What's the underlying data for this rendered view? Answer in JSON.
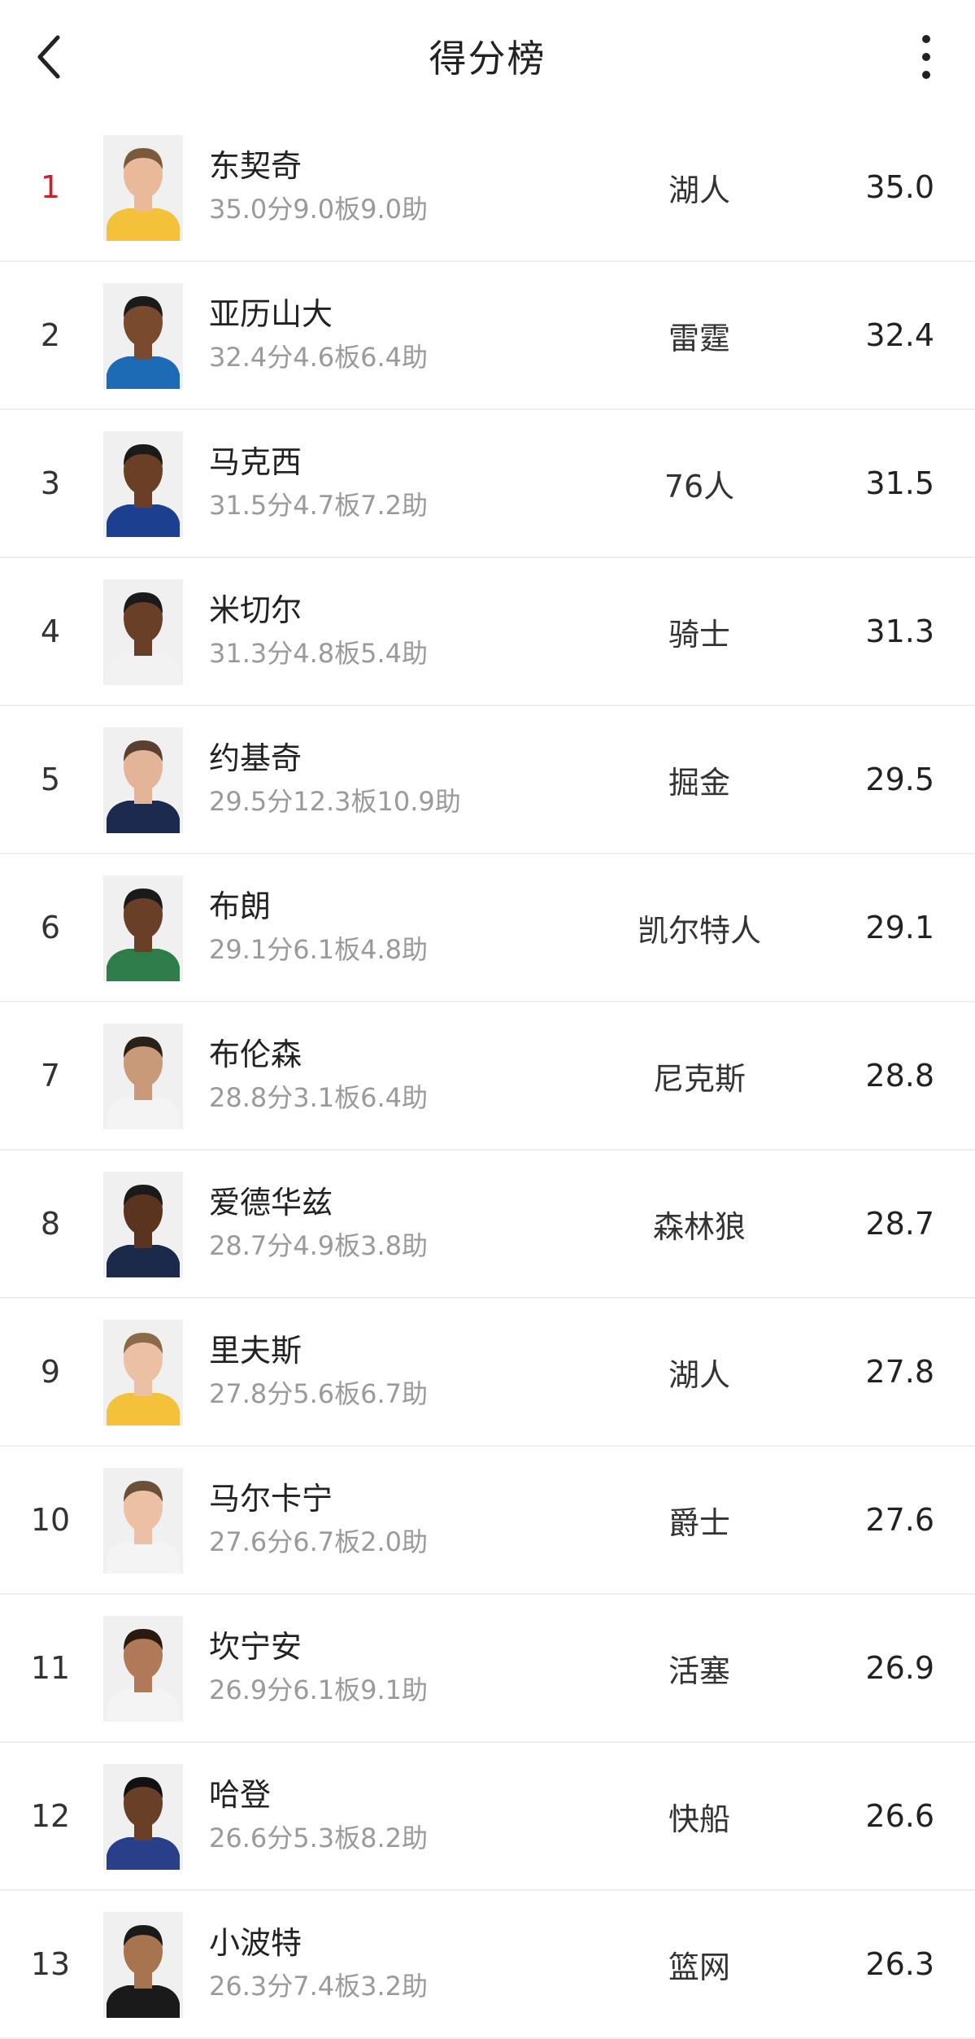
{
  "header": {
    "title": "得分榜",
    "back_icon": "chevron-left-icon",
    "more_icon": "more-vertical-icon"
  },
  "colors": {
    "highlight_rank": "#c8232c",
    "stats_text": "#9a9a9a"
  },
  "rows": [
    {
      "rank": "1",
      "name": "东契奇",
      "stats": "35.0分9.0板9.0助",
      "team": "湖人",
      "points": "35.0",
      "jersey": "#f3c13a",
      "skin": "#e9b99a",
      "hair": "#7a5a3a"
    },
    {
      "rank": "2",
      "name": "亚历山大",
      "stats": "32.4分4.6板6.4助",
      "team": "雷霆",
      "points": "32.4",
      "jersey": "#1e6bb5",
      "skin": "#7a4a2e",
      "hair": "#1a1a1a"
    },
    {
      "rank": "3",
      "name": "马克西",
      "stats": "31.5分4.7板7.2助",
      "team": "76人",
      "points": "31.5",
      "jersey": "#1c3f8f",
      "skin": "#6b3f26",
      "hair": "#1a1a1a"
    },
    {
      "rank": "4",
      "name": "米切尔",
      "stats": "31.3分4.8板5.4助",
      "team": "骑士",
      "points": "31.3",
      "jersey": "#f2f2f2",
      "skin": "#6a3f28",
      "hair": "#1a1a1a"
    },
    {
      "rank": "5",
      "name": "约基奇",
      "stats": "29.5分12.3板10.9助",
      "team": "掘金",
      "points": "29.5",
      "jersey": "#1d2a4f",
      "skin": "#e4b498",
      "hair": "#5a4030"
    },
    {
      "rank": "6",
      "name": "布朗",
      "stats": "29.1分6.1板4.8助",
      "team": "凯尔特人",
      "points": "29.1",
      "jersey": "#2e7d4a",
      "skin": "#6a3f28",
      "hair": "#1a1a1a"
    },
    {
      "rank": "7",
      "name": "布伦森",
      "stats": "28.8分3.1板6.4助",
      "team": "尼克斯",
      "points": "28.8",
      "jersey": "#f4f4f4",
      "skin": "#c99a7a",
      "hair": "#2a2018"
    },
    {
      "rank": "8",
      "name": "爱德华兹",
      "stats": "28.7分4.9板3.8助",
      "team": "森林狼",
      "points": "28.7",
      "jersey": "#1b2a4a",
      "skin": "#5a341f",
      "hair": "#1a1a1a"
    },
    {
      "rank": "9",
      "name": "里夫斯",
      "stats": "27.8分5.6板6.7助",
      "team": "湖人",
      "points": "27.8",
      "jersey": "#f3c13a",
      "skin": "#ecc0a4",
      "hair": "#8a6a48"
    },
    {
      "rank": "10",
      "name": "马尔卡宁",
      "stats": "27.6分6.7板2.0助",
      "team": "爵士",
      "points": "27.6",
      "jersey": "#f4f4f4",
      "skin": "#ecc0a4",
      "hair": "#6a5038"
    },
    {
      "rank": "11",
      "name": "坎宁安",
      "stats": "26.9分6.1板9.1助",
      "team": "活塞",
      "points": "26.9",
      "jersey": "#f4f4f4",
      "skin": "#b07a58",
      "hair": "#2a1a10"
    },
    {
      "rank": "12",
      "name": "哈登",
      "stats": "26.6分5.3板8.2助",
      "team": "快船",
      "points": "26.6",
      "jersey": "#2a3f8a",
      "skin": "#6a3f28",
      "hair": "#111111"
    },
    {
      "rank": "13",
      "name": "小波特",
      "stats": "26.3分7.4板3.2助",
      "team": "篮网",
      "points": "26.3",
      "jersey": "#1a1a1a",
      "skin": "#a8734f",
      "hair": "#1a1a1a"
    }
  ]
}
